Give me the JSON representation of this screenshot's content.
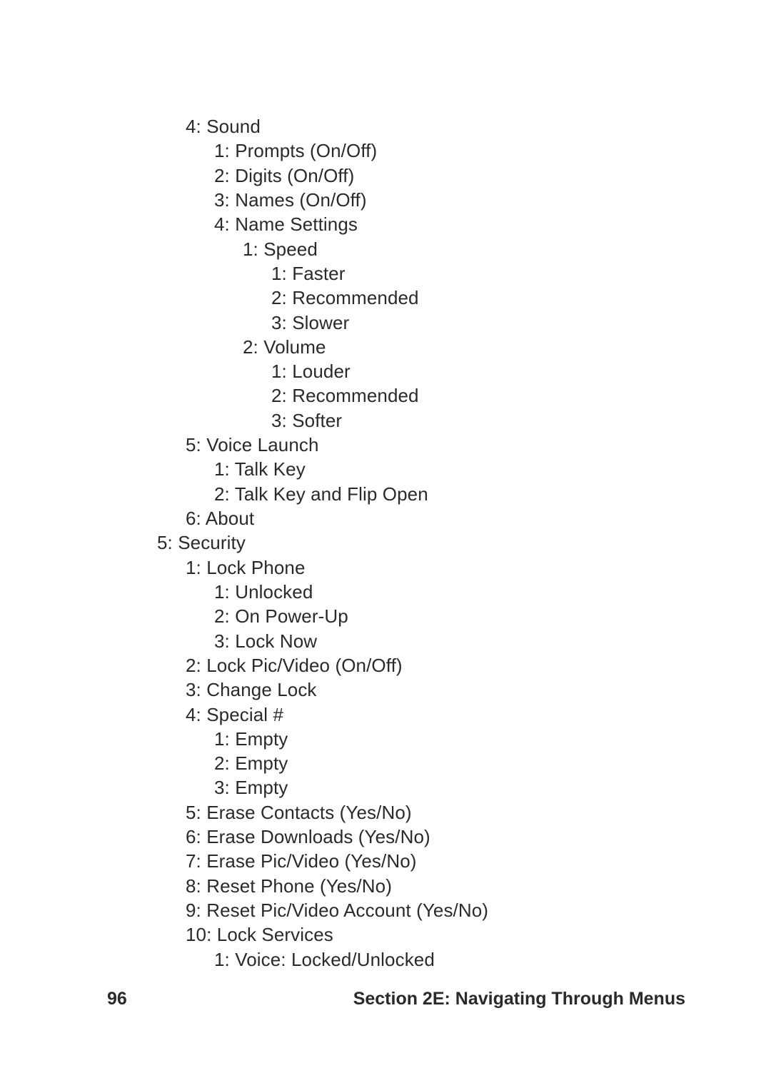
{
  "pageNumber": "96",
  "sectionTitle": "Section 2E: Navigating Through Menus",
  "lines": [
    {
      "lvl": 1,
      "text": "4: Sound"
    },
    {
      "lvl": 2,
      "text": "1: Prompts (On/Off)"
    },
    {
      "lvl": 2,
      "text": "2: Digits (On/Off)"
    },
    {
      "lvl": 2,
      "text": "3: Names (On/Off)"
    },
    {
      "lvl": 2,
      "text": "4: Name Settings"
    },
    {
      "lvl": 3,
      "text": "1: Speed"
    },
    {
      "lvl": 4,
      "text": "1: Faster"
    },
    {
      "lvl": 4,
      "text": "2: Recommended"
    },
    {
      "lvl": 4,
      "text": "3: Slower"
    },
    {
      "lvl": 3,
      "text": "2: Volume"
    },
    {
      "lvl": 4,
      "text": "1: Louder"
    },
    {
      "lvl": 4,
      "text": "2: Recommended"
    },
    {
      "lvl": 4,
      "text": "3: Softer"
    },
    {
      "lvl": 1,
      "text": "5: Voice Launch"
    },
    {
      "lvl": 2,
      "text": "1: Talk Key"
    },
    {
      "lvl": 2,
      "text": "2: Talk Key and Flip Open"
    },
    {
      "lvl": 1,
      "text": "6: About"
    },
    {
      "lvl": 0,
      "text": "5: Security"
    },
    {
      "lvl": 1,
      "text": "1: Lock Phone"
    },
    {
      "lvl": 2,
      "text": "1: Unlocked"
    },
    {
      "lvl": 2,
      "text": "2: On Power-Up"
    },
    {
      "lvl": 2,
      "text": "3: Lock Now"
    },
    {
      "lvl": 1,
      "text": "2: Lock Pic/Video (On/Off)"
    },
    {
      "lvl": 1,
      "text": "3: Change Lock"
    },
    {
      "lvl": 1,
      "text": "4: Special #"
    },
    {
      "lvl": 2,
      "text": "1: Empty"
    },
    {
      "lvl": 2,
      "text": "2: Empty"
    },
    {
      "lvl": 2,
      "text": "3: Empty"
    },
    {
      "lvl": 1,
      "text": "5: Erase Contacts (Yes/No)"
    },
    {
      "lvl": 1,
      "text": "6: Erase Downloads (Yes/No)"
    },
    {
      "lvl": 1,
      "text": "7: Erase Pic/Video (Yes/No)"
    },
    {
      "lvl": 1,
      "text": "8: Reset Phone (Yes/No)"
    },
    {
      "lvl": 1,
      "text": "9: Reset Pic/Video Account (Yes/No)"
    },
    {
      "lvl": 1,
      "text": "10: Lock Services"
    },
    {
      "lvl": 2,
      "text": "1: Voice: Locked/Unlocked"
    }
  ]
}
